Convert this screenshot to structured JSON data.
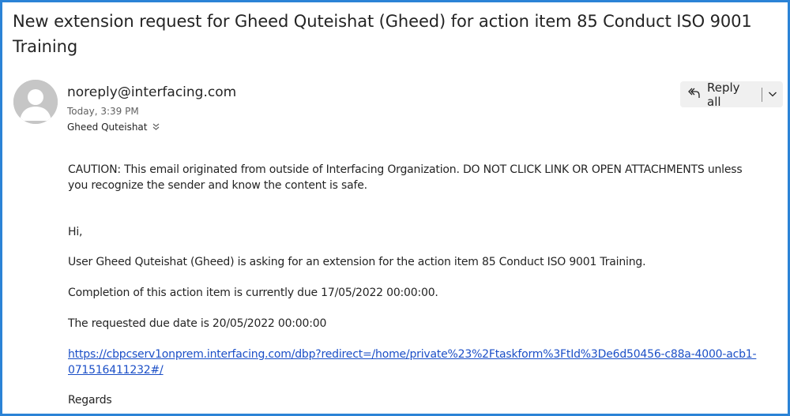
{
  "email": {
    "subject": "New extension request for Gheed Quteishat (Gheed) for action item 85 Conduct ISO 9001 Training",
    "sender": "noreply@interfacing.com",
    "time": "Today, 3:39 PM",
    "recipient": "Gheed Quteishat",
    "reply_all_label": "Reply all",
    "body": {
      "caution": "CAUTION: This email originated from outside of Interfacing Organization. DO NOT CLICK LINK OR OPEN ATTACHMENTS unless you recognize the sender and know the content is safe.",
      "greeting": "Hi,",
      "line1": "User Gheed Quteishat (Gheed) is asking for an extension for the action item 85 Conduct ISO 9001 Training.",
      "line2": "Completion of this action item is currently due 17/05/2022 00:00:00.",
      "line3": "The requested due date is 20/05/2022 00:00:00",
      "link": "https://cbpcserv1onprem.interfacing.com/dbp?redirect=/home/private%23%2Ftaskform%3FtId%3De6d50456-c88a-4000-acb1-071516411232#/",
      "closing": "Regards"
    }
  },
  "icons": {
    "avatar": "person-silhouette-icon",
    "reply_all": "reply-all-icon",
    "expand": "chevron-down-icon",
    "recipients_expand": "double-chevron-down-icon"
  },
  "colors": {
    "frame_border": "#2b83d6",
    "link": "#1b4fc7",
    "button_bg": "#f0f0f0"
  }
}
